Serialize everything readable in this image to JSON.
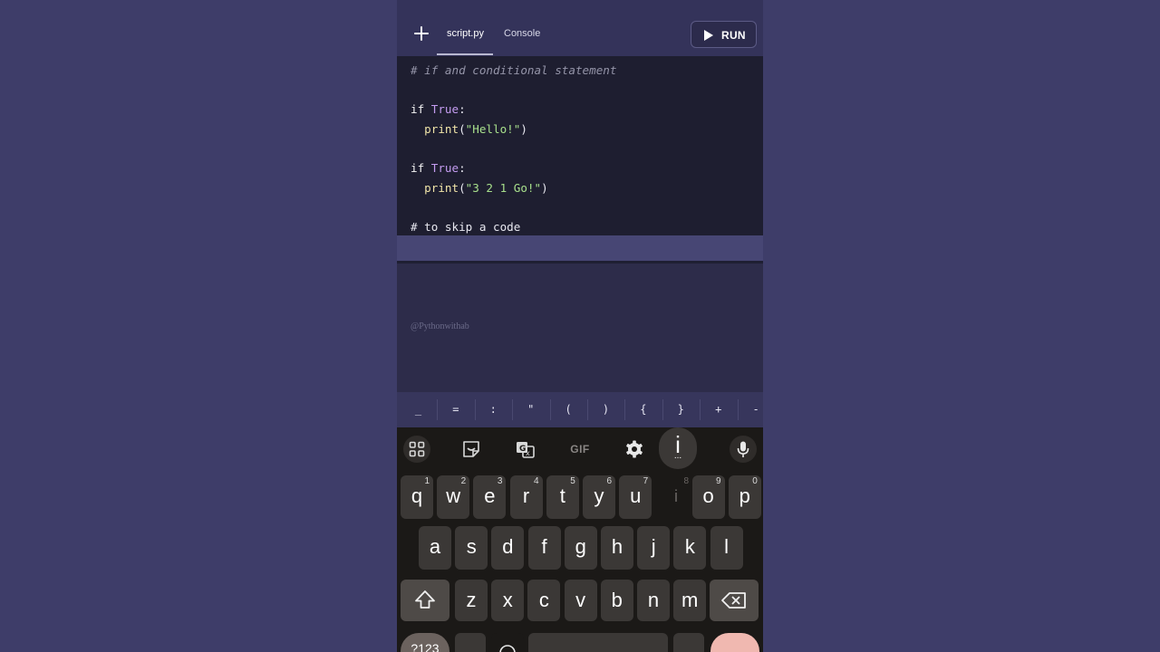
{
  "header": {
    "tabs": [
      {
        "label": "script.py",
        "active": true
      },
      {
        "label": "Console",
        "active": false
      }
    ],
    "run_label": "RUN"
  },
  "editor": {
    "lines": [
      {
        "tokens": [
          {
            "t": "# if and conditional statement",
            "c": "comment"
          }
        ]
      },
      {
        "tokens": [
          {
            "t": "if ",
            "c": "kw"
          },
          {
            "t": "True",
            "c": "const"
          },
          {
            "t": ":",
            "c": "plain"
          }
        ]
      },
      {
        "tokens": [
          {
            "t": "  print",
            "c": "fn"
          },
          {
            "t": "(",
            "c": "plain"
          },
          {
            "t": "\"Hello!\"",
            "c": "str"
          },
          {
            "t": ")",
            "c": "plain"
          }
        ]
      },
      {
        "tokens": [
          {
            "t": "if ",
            "c": "kw"
          },
          {
            "t": "True",
            "c": "const"
          },
          {
            "t": ":",
            "c": "plain"
          }
        ]
      },
      {
        "tokens": [
          {
            "t": "  print",
            "c": "fn"
          },
          {
            "t": "(",
            "c": "plain"
          },
          {
            "t": "\"3 2 1 Go!\"",
            "c": "str"
          },
          {
            "t": ")",
            "c": "plain"
          }
        ]
      },
      {
        "tokens": [
          {
            "t": "# to skip a code",
            "c": "plain"
          }
        ]
      }
    ]
  },
  "console": {
    "watermark": "@Pythonwithab"
  },
  "symbol_bar": {
    "symbols": [
      "_",
      "=",
      ":",
      "\"",
      "(",
      ")",
      "{",
      "}",
      "+",
      "-"
    ]
  },
  "keyboard": {
    "toolbar": {
      "gif_label": "GIF",
      "icons": [
        "apps-grid-icon",
        "sticker-icon",
        "translate-icon",
        "gif-icon",
        "settings-gear-icon",
        "microphone-icon"
      ]
    },
    "popup_letter": "i",
    "popup_more": "...",
    "row1": [
      {
        "key": "q",
        "num": "1"
      },
      {
        "key": "w",
        "num": "2"
      },
      {
        "key": "e",
        "num": "3"
      },
      {
        "key": "r",
        "num": "4"
      },
      {
        "key": "t",
        "num": "5"
      },
      {
        "key": "y",
        "num": "6"
      },
      {
        "key": "u",
        "num": "7"
      },
      {
        "key": "i",
        "num": "8"
      },
      {
        "key": "o",
        "num": "9"
      },
      {
        "key": "p",
        "num": "0"
      }
    ],
    "row2": [
      "a",
      "s",
      "d",
      "f",
      "g",
      "h",
      "j",
      "k",
      "l"
    ],
    "row3": [
      "z",
      "x",
      "c",
      "v",
      "b",
      "n",
      "m"
    ],
    "bottom_left_label": "?123",
    "colors": {
      "keyboard_bg": "#1b1917",
      "key_bg": "#3b3836",
      "enter_key": "#f0b8b0"
    }
  }
}
